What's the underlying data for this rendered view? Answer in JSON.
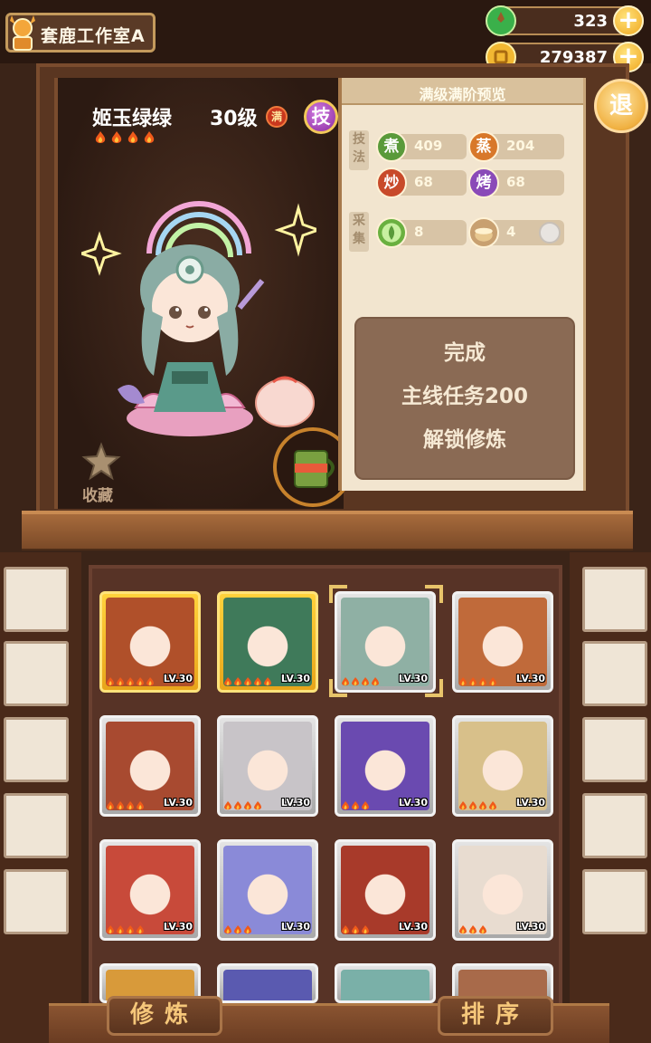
{
  "header": {
    "studio_name": "套鹿工作室A",
    "currency_1": {
      "value": "323",
      "icon": "green-gem-icon"
    },
    "currency_2": {
      "value": "279387",
      "icon": "gold-coin-icon"
    },
    "plus_label": "+"
  },
  "character": {
    "name": "姬玉绿绿",
    "level": "30级",
    "max_badge": "满",
    "skill_badge": "技",
    "stars": 4
  },
  "favorite_label": "收藏",
  "preview": {
    "title": "满级满阶预览",
    "tag_skill": "技法",
    "tag_gather": "采集",
    "stats": [
      {
        "icon": "煮",
        "value": "409",
        "color": "#5a9a3a"
      },
      {
        "icon": "蒸",
        "value": "204",
        "color": "#d8782a"
      },
      {
        "icon": "炒",
        "value": "68",
        "color": "#c84a2a"
      },
      {
        "icon": "烤",
        "value": "68",
        "color": "#8a4ab8"
      }
    ],
    "gather": [
      {
        "icon": "vegetable-icon",
        "value": "8"
      },
      {
        "icon": "grain-basket-icon",
        "value": "4"
      }
    ],
    "unlock": {
      "line1": "完成",
      "line2": "主线任务200",
      "line3": "解锁修炼"
    }
  },
  "back_label": "退",
  "buttons": {
    "train": "修炼",
    "sort": "排序"
  },
  "roster": [
    {
      "tier": "gold",
      "lv": "LV.30",
      "flames": 5,
      "theme": "#b0502a"
    },
    {
      "tier": "gold",
      "lv": "LV.30",
      "flames": 5,
      "theme": "#3f7a5a"
    },
    {
      "tier": "silver",
      "lv": "LV.30",
      "flames": 4,
      "theme": "#8fb0a4"
    },
    {
      "tier": "silver",
      "lv": "LV.30",
      "flames": 4,
      "theme": "#c06a3a"
    },
    {
      "tier": "silver",
      "lv": "LV.30",
      "flames": 4,
      "theme": "#a84a30"
    },
    {
      "tier": "silver",
      "lv": "LV.30",
      "flames": 4,
      "theme": "#c8c4c8"
    },
    {
      "tier": "silver",
      "lv": "LV.30",
      "flames": 3,
      "theme": "#6a4ab0"
    },
    {
      "tier": "silver",
      "lv": "LV.30",
      "flames": 4,
      "theme": "#d8c08a"
    },
    {
      "tier": "silver",
      "lv": "LV.30",
      "flames": 4,
      "theme": "#c84a3a"
    },
    {
      "tier": "silver",
      "lv": "LV.30",
      "flames": 3,
      "theme": "#8a8ad8"
    },
    {
      "tier": "silver",
      "lv": "LV.30",
      "flames": 3,
      "theme": "#a83a2a"
    },
    {
      "tier": "silver",
      "lv": "LV.30",
      "flames": 3,
      "theme": "#e8dcd0"
    }
  ],
  "roster_partial": [
    {
      "theme": "#d89a3a"
    },
    {
      "theme": "#5a5ab0"
    },
    {
      "theme": "#7ab0a8"
    },
    {
      "theme": "#a86a4a"
    }
  ]
}
